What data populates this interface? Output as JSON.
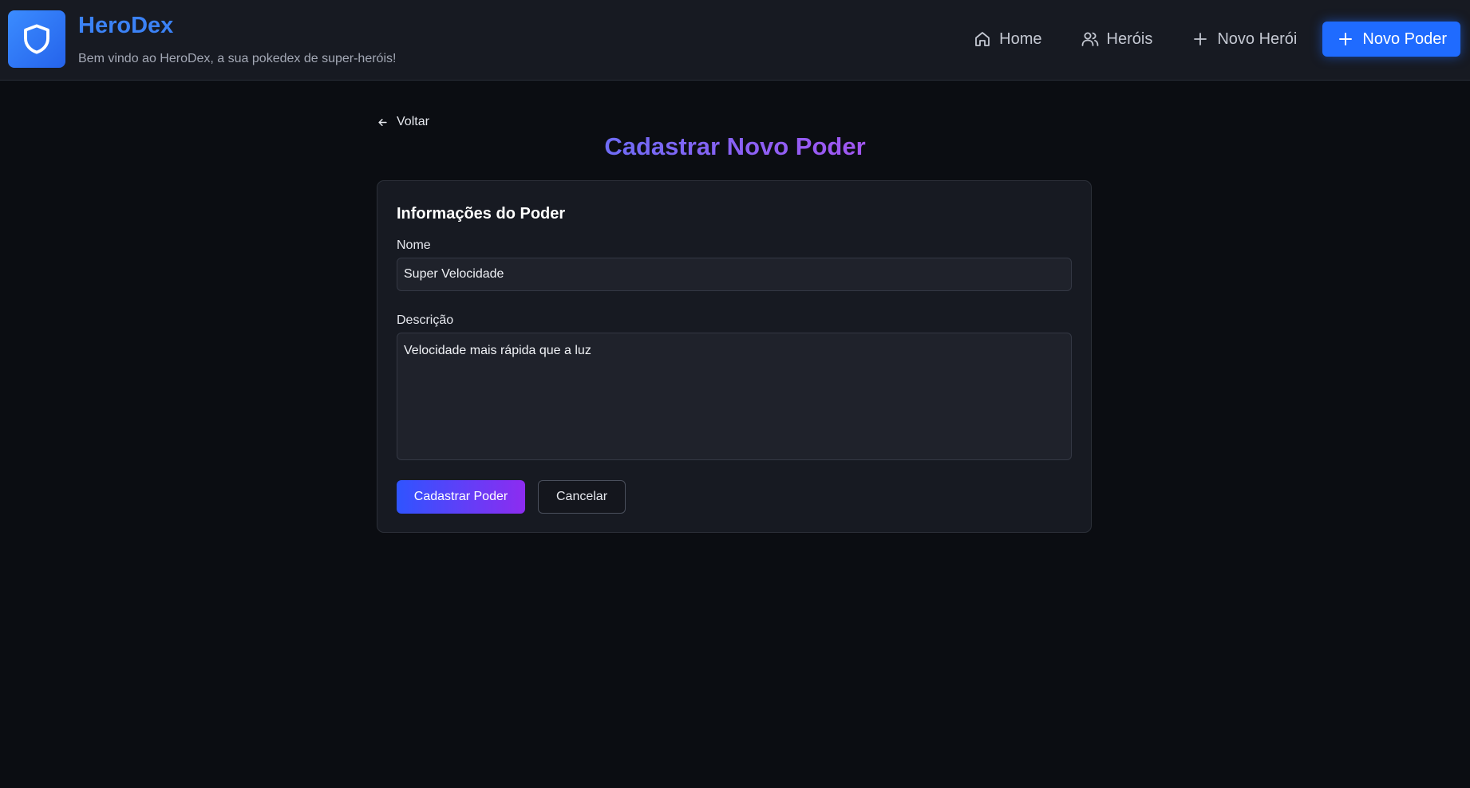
{
  "header": {
    "title": "HeroDex",
    "subtitle": "Bem vindo ao HeroDex, a sua pokedex de super-heróis!",
    "logo_icon": "shield-icon",
    "brand_color": "#3b82f6"
  },
  "nav": {
    "items": [
      {
        "label": "Home",
        "icon": "home-icon"
      },
      {
        "label": "Heróis",
        "icon": "users-icon"
      },
      {
        "label": "Novo Herói",
        "icon": "plus-icon"
      },
      {
        "label": "Novo Poder",
        "icon": "plus-icon",
        "active": true
      }
    ],
    "active_color": "#1f6bff"
  },
  "page": {
    "back_label": "Voltar",
    "title": "Cadastrar Novo Poder"
  },
  "form": {
    "section_title": "Informações do Poder",
    "name_label": "Nome",
    "name_value": "Super Velocidade",
    "description_label": "Descrição",
    "description_value": "Velocidade mais rápida que a luz",
    "submit_label": "Cadastrar Poder",
    "cancel_label": "Cancelar"
  }
}
